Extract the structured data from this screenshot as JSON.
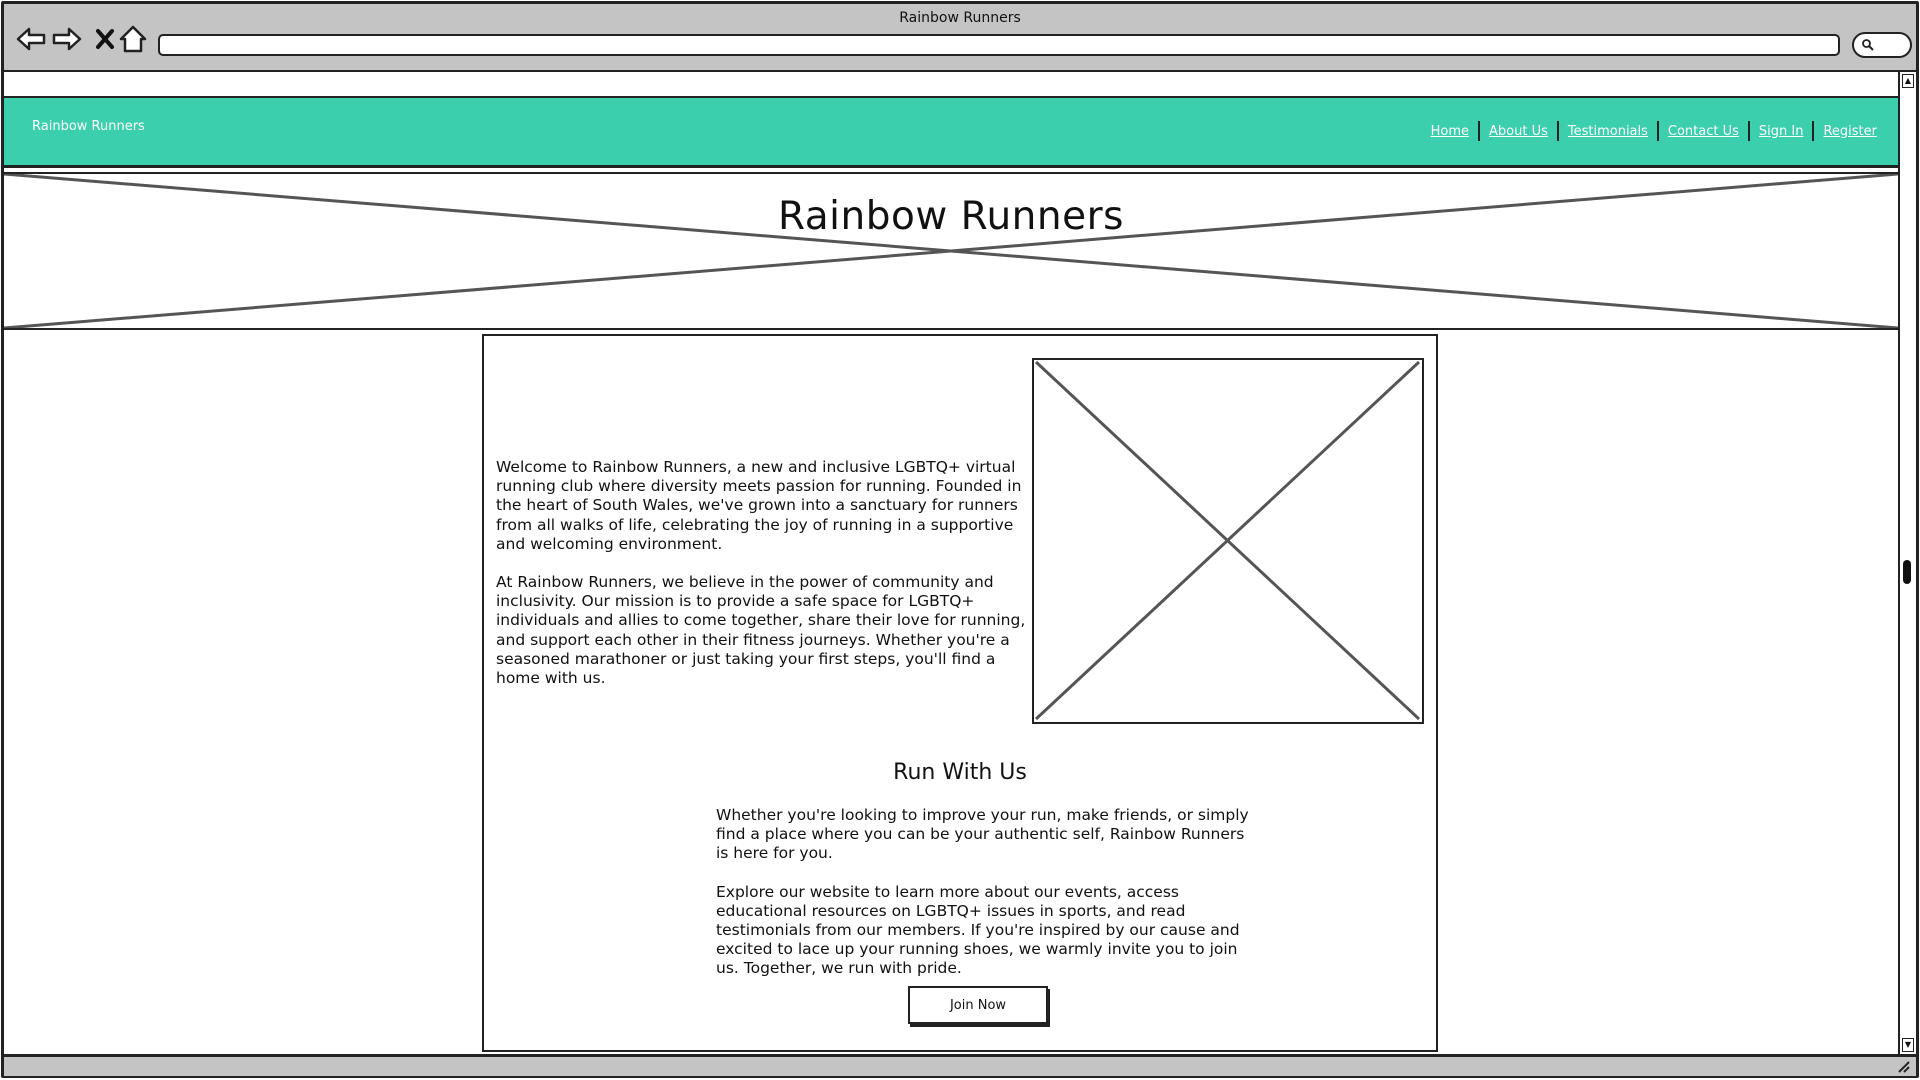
{
  "browser": {
    "window_title": "Rainbow Runners",
    "address_value": "",
    "icons": [
      "back-arrow-icon",
      "forward-arrow-icon",
      "close-icon",
      "home-icon",
      "search-icon"
    ]
  },
  "header": {
    "brand": "Rainbow Runners",
    "nav": [
      {
        "label": "Home"
      },
      {
        "label": "About Us"
      },
      {
        "label": "Testimonials"
      },
      {
        "label": "Contact Us"
      },
      {
        "label": "Sign In"
      },
      {
        "label": "Register"
      }
    ],
    "accent_color": "#3ccfae"
  },
  "hero": {
    "title": "Rainbow Runners"
  },
  "main": {
    "intro_paragraphs": [
      "Welcome to Rainbow Runners, a new and inclusive LGBTQ+ virtual running club where diversity meets passion for running. Founded in the heart of South Wales, we've grown into a sanctuary for runners from all walks of life, celebrating the joy of running in a supportive and welcoming environment.",
      "At Rainbow Runners, we believe in the power of community and inclusivity. Our mission is to provide a safe space for LGBTQ+ individuals and allies to come together, share their love for running, and support each other in their fitness journeys. Whether you're a seasoned marathoner or just taking your first steps, you'll find a home with us."
    ],
    "run_heading": "Run With Us",
    "run_paragraphs": [
      "Whether you're looking to improve your run, make friends, or simply find a place where you can be your authentic self, Rainbow Runners is here for you.",
      "Explore our website to learn more about our events, access educational resources on LGBTQ+ issues in sports, and read testimonials from our members. If you're inspired by our cause and excited to lace up your running shoes, we warmly invite you to join us. Together, we run with pride."
    ],
    "join_button": "Join Now"
  }
}
